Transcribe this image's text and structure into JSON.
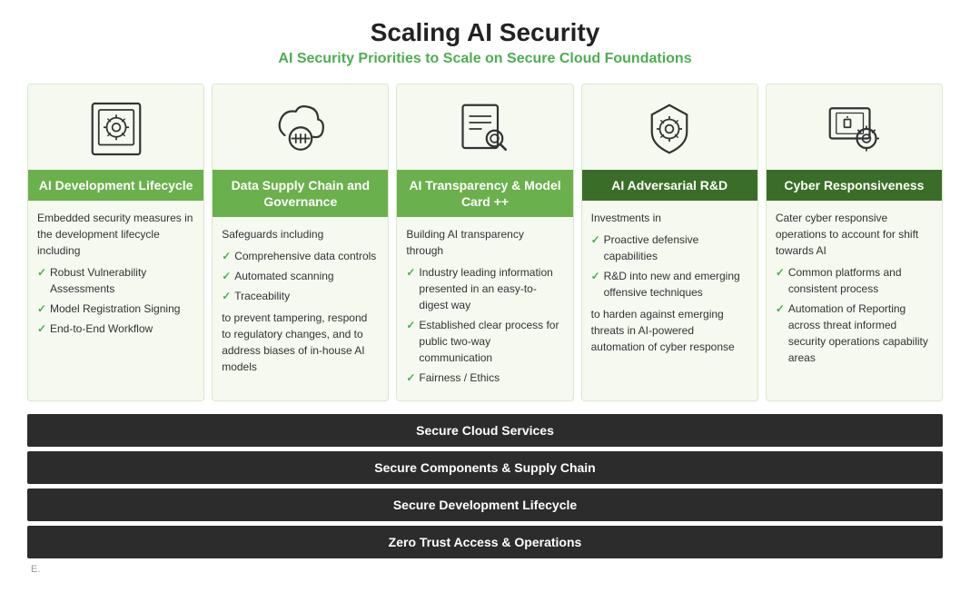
{
  "header": {
    "title": "Scaling AI Security",
    "subtitle": "AI Security Priorities to Scale on Secure Cloud Foundations"
  },
  "columns": [
    {
      "id": "col1",
      "header": "AI Development Lifecycle",
      "header_style": "green",
      "intro": "Embedded security measures in the development lifecycle including",
      "bullets": [
        "Robust Vulnerability Assessments",
        "Model Registration Signing",
        "End-to-End Workflow"
      ],
      "extra": ""
    },
    {
      "id": "col2",
      "header": "Data Supply Chain and Governance",
      "header_style": "green",
      "intro": "Safeguards including",
      "bullets": [
        "Comprehensive data controls",
        "Automated scanning",
        "Traceability"
      ],
      "extra": "to prevent tampering, respond to regulatory changes, and to address biases of in-house AI models"
    },
    {
      "id": "col3",
      "header": "AI Transparency & Model Card ++",
      "header_style": "green",
      "intro": "Building AI transparency through",
      "bullets": [
        "Industry leading information presented in an easy-to-digest way",
        "Established clear process for public two-way communication",
        "Fairness / Ethics"
      ],
      "extra": ""
    },
    {
      "id": "col4",
      "header": "AI Adversarial R&D",
      "header_style": "dark",
      "intro": "Investments in",
      "bullets": [
        "Proactive defensive capabilities",
        "R&D into new and emerging offensive techniques"
      ],
      "extra": "to harden against emerging threats in AI-powered automation of cyber response"
    },
    {
      "id": "col5",
      "header": "Cyber Responsiveness",
      "header_style": "dark",
      "intro": "Cater cyber responsive operations to account for shift towards AI",
      "bullets": [
        "Common platforms and consistent process",
        "Automation of Reporting across threat informed security operations capability areas"
      ],
      "extra": ""
    }
  ],
  "bottom_bars": [
    "Secure Cloud Services",
    "Secure Components & Supply Chain",
    "Secure Development Lifecycle",
    "Zero Trust Access & Operations"
  ],
  "footer": "E."
}
